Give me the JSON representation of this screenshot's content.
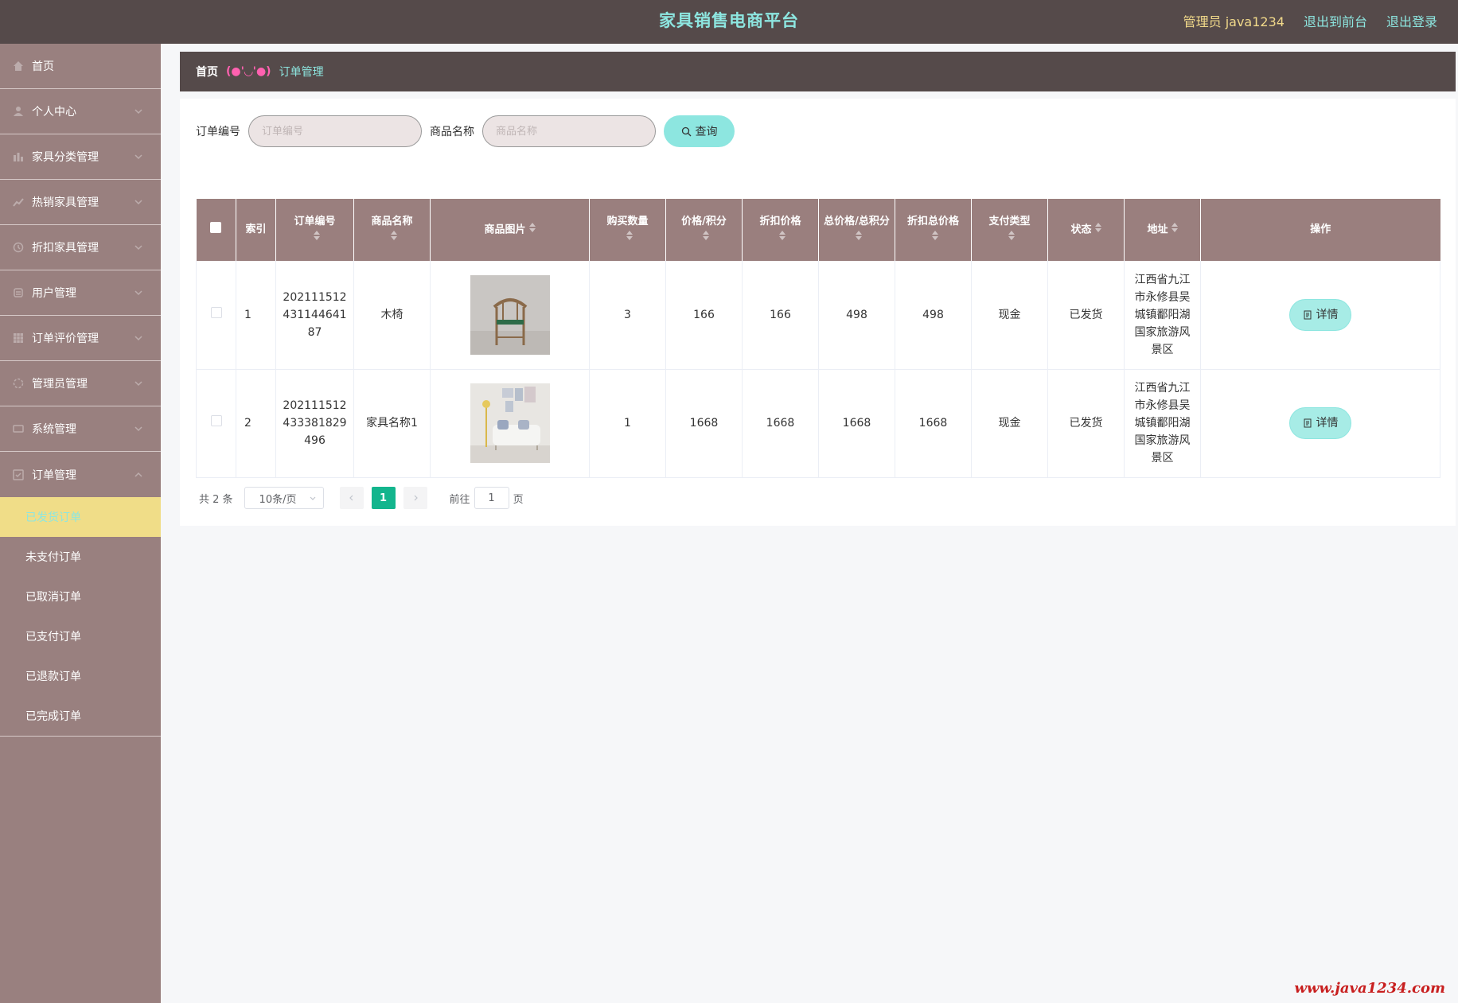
{
  "header": {
    "title": "家具销售电商平台",
    "admin_label": "管理员 java1234",
    "front_link": "退出到前台",
    "logout_link": "退出登录",
    "colors": {
      "bar": "#554a4a",
      "accent": "#8de6e0",
      "admin": "#f1d98a"
    }
  },
  "sidebar": {
    "items": [
      {
        "label": "首页",
        "icon": "home-icon"
      },
      {
        "label": "个人中心",
        "icon": "user-icon"
      },
      {
        "label": "家具分类管理",
        "icon": "category-icon"
      },
      {
        "label": "热销家具管理",
        "icon": "chart-icon"
      },
      {
        "label": "折扣家具管理",
        "icon": "clock-icon"
      },
      {
        "label": "用户管理",
        "icon": "users-icon"
      },
      {
        "label": "订单评价管理",
        "icon": "grid-icon"
      },
      {
        "label": "管理员管理",
        "icon": "admin-icon"
      },
      {
        "label": "系统管理",
        "icon": "settings-icon"
      },
      {
        "label": "订单管理",
        "icon": "order-icon"
      }
    ],
    "submenu": [
      {
        "label": "已发货订单",
        "active": true
      },
      {
        "label": "未支付订单"
      },
      {
        "label": "已取消订单"
      },
      {
        "label": "已支付订单"
      },
      {
        "label": "已退款订单"
      },
      {
        "label": "已完成订单"
      }
    ]
  },
  "breadcrumb": {
    "home": "首页",
    "separator": "(●'◡'●)",
    "current": "订单管理"
  },
  "search": {
    "order_no_label": "订单编号",
    "order_no_placeholder": "订单编号",
    "product_label": "商品名称",
    "product_placeholder": "商品名称",
    "query_button": "查询"
  },
  "table": {
    "headers": {
      "index": "索引",
      "order_no": "订单编号",
      "product_name": "商品名称",
      "product_image": "商品图片",
      "quantity": "购买数量",
      "price": "价格/积分",
      "discount_price": "折扣价格",
      "total": "总价格/总积分",
      "discount_total": "折扣总价格",
      "pay_type": "支付类型",
      "status": "状态",
      "address": "地址",
      "actions": "操作"
    },
    "rows": [
      {
        "index": "1",
        "order_no": "20211151243114464187",
        "product_name": "木椅",
        "image": "chair",
        "quantity": "3",
        "price": "166",
        "discount_price": "166",
        "total": "498",
        "discount_total": "498",
        "pay_type": "现金",
        "status": "已发货",
        "address": "江西省九江市永修县吴城镇鄱阳湖国家旅游风景区",
        "detail": "详情"
      },
      {
        "index": "2",
        "order_no": "202111512433381829496",
        "product_name": "家具名称1",
        "image": "sofa",
        "quantity": "1",
        "price": "1668",
        "discount_price": "1668",
        "total": "1668",
        "discount_total": "1668",
        "pay_type": "现金",
        "status": "已发货",
        "address": "江西省九江市永修县吴城镇鄱阳湖国家旅游风景区",
        "detail": "详情"
      }
    ]
  },
  "pagination": {
    "total": "共 2 条",
    "page_size": "10条/页",
    "current_page": "1",
    "goto_label": "前往",
    "goto_value": "1",
    "page_suffix": "页"
  },
  "watermark": "www.java1234.com"
}
